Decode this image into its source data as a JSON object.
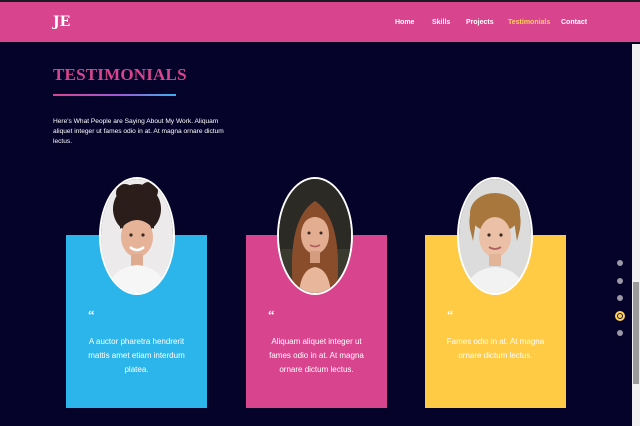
{
  "navbar": {
    "logo": "JE",
    "links": [
      "Home",
      "Skills",
      "Projects",
      "Testimonials",
      "Contact"
    ],
    "active_link": "Testimonials"
  },
  "section": {
    "title": "TESTIMONIALS",
    "intro": "Here's What People are Saying About My Work. Aliquam aliquet integer ut fames odio in at. At magna ornare dictum lectus."
  },
  "testimonials": [
    {
      "quote_mark": "“",
      "text": "A auctor pharetra hendrerit mattis amet etiam interdum platea.",
      "card_color": "#2bb5ea"
    },
    {
      "quote_mark": "“",
      "text": "Aliquam aliquet integer ut fames odio in at. At magna ornare dictum lectus.",
      "card_color": "#d9448e"
    },
    {
      "quote_mark": "“",
      "text": "Fames odio in at. At magna ornare dictum lectus.",
      "card_color": "#ffca44"
    }
  ],
  "colors": {
    "accent": "#d9448e",
    "background": "#06032a",
    "highlight": "#ffd25a"
  },
  "pagination": {
    "total": 5,
    "active": 4
  }
}
